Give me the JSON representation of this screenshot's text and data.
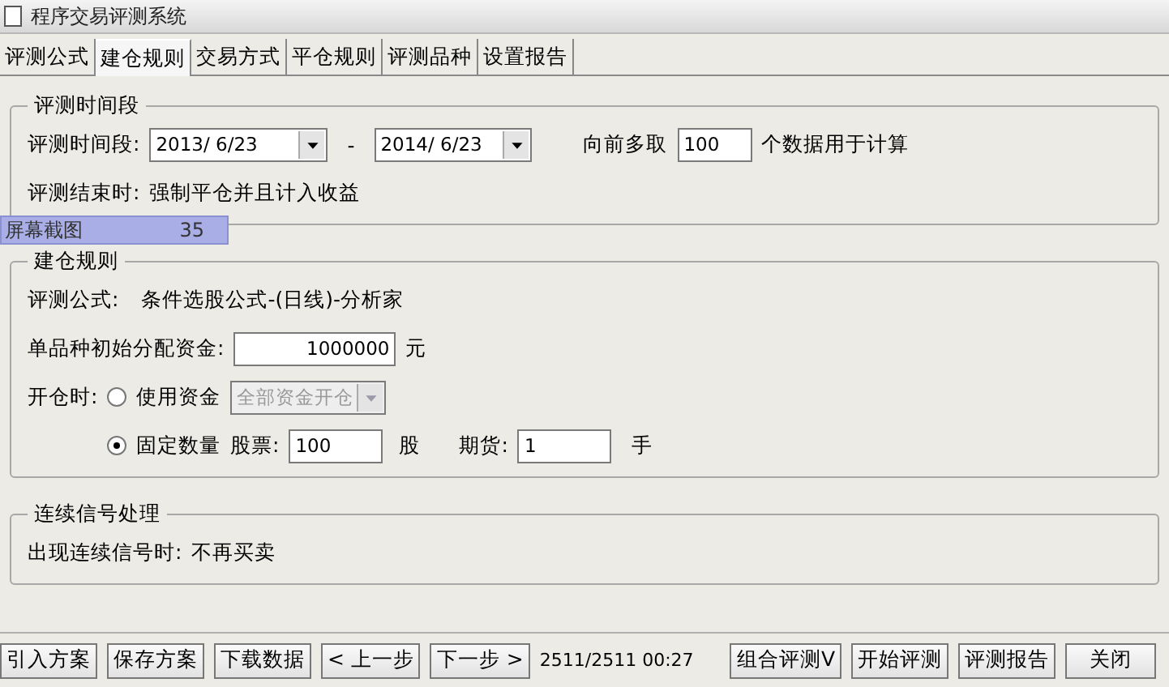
{
  "window": {
    "title": "程序交易评测系统"
  },
  "tabs": [
    {
      "label": "评测公式",
      "selected": false
    },
    {
      "label": "建仓规则",
      "selected": true
    },
    {
      "label": "交易方式",
      "selected": false
    },
    {
      "label": "平仓规则",
      "selected": false
    },
    {
      "label": "评测品种",
      "selected": false
    },
    {
      "label": "设置报告",
      "selected": false
    }
  ],
  "period": {
    "title": "评测时间段",
    "label": "评测时间段:",
    "start": "2013/ 6/23",
    "separator": "-",
    "end": "2014/ 6/23",
    "lookback_label": "向前多取",
    "lookback_value": "100",
    "lookback_suffix": "个数据用于计算",
    "end_label": "评测结束时:",
    "end_value": "强制平仓并且计入收益"
  },
  "overlay": {
    "label": "屏幕截图",
    "count": "35"
  },
  "open_rules": {
    "title": "建仓规则",
    "formula_label": "评测公式:",
    "formula_value": "条件选股公式-(日线)-分析家",
    "capital_label": "单品种初始分配资金:",
    "capital_value": "1000000",
    "capital_unit": "元",
    "open_label": "开仓时:",
    "options": [
      {
        "label": "使用资金",
        "selected": false,
        "select_value": "全部资金开仓",
        "disabled": true
      },
      {
        "label": "固定数量",
        "selected": true,
        "stock_label": "股票:",
        "stock_value": "100",
        "stock_unit": "股",
        "futures_label": "期货:",
        "futures_value": "1",
        "futures_unit": "手"
      }
    ]
  },
  "signals": {
    "title": "连续信号处理",
    "label": "出现连续信号时:",
    "value": "不再买卖"
  },
  "buttons_left": [
    "引入方案",
    "保存方案",
    "下载数据",
    "< 上一步",
    "下一步 >"
  ],
  "progress": "2511/2511 00:27",
  "buttons_right": [
    "组合评测V",
    "开始评测",
    "评测报告",
    "关闭"
  ]
}
